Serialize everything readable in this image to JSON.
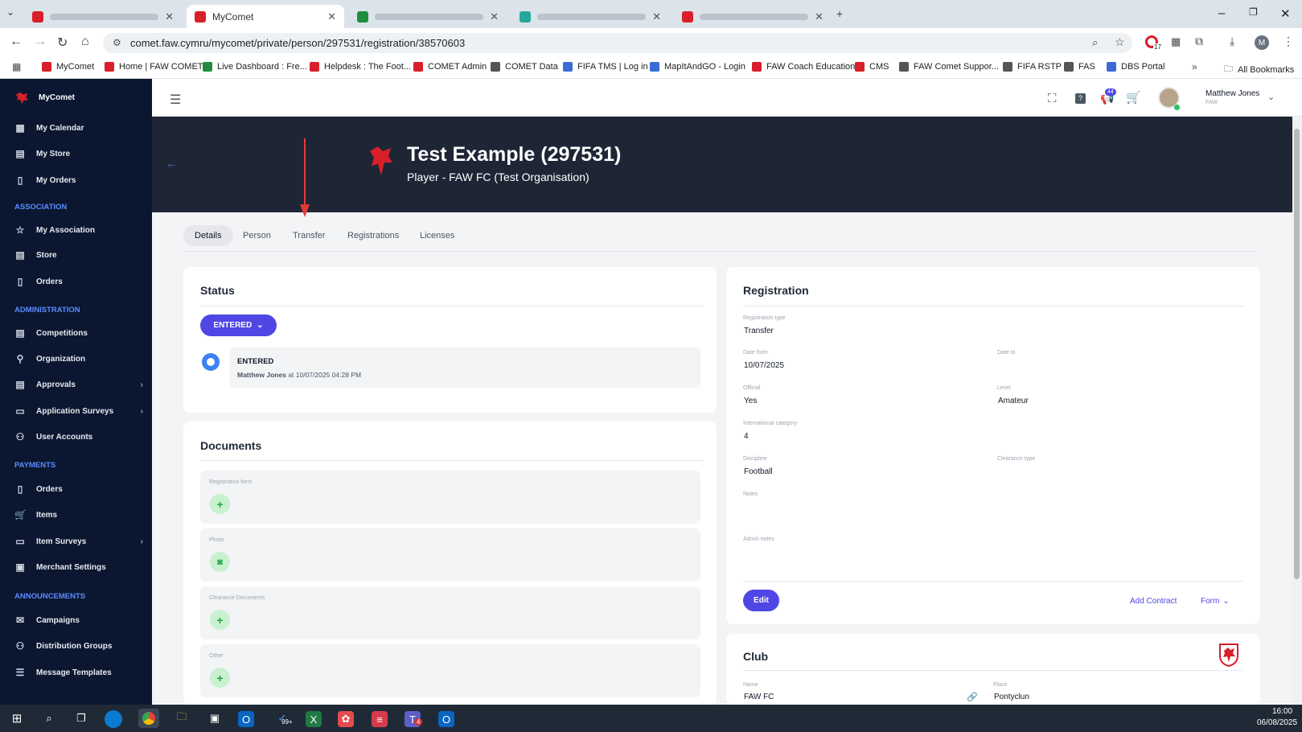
{
  "browser": {
    "tabs": [
      {
        "label": "",
        "active": false
      },
      {
        "label": "MyComet",
        "active": true
      },
      {
        "label": "",
        "active": false
      },
      {
        "label": "",
        "active": false
      },
      {
        "label": "",
        "active": false
      }
    ],
    "url": "comet.faw.cymru/mycomet/private/person/297531/registration/38570603",
    "extension_badge": "17",
    "profile_initial": "M",
    "bookmarks": [
      "MyComet",
      "Home | FAW COMET",
      "Live Dashboard : Fre...",
      "Helpdesk : The Foot...",
      "COMET Admin",
      "COMET Data",
      "FIFA TMS | Log in",
      "MapItAndGO - Login",
      "FAW Coach Education",
      "CMS",
      "FAW Comet Suppor...",
      "FIFA RSTP",
      "FAS",
      "DBS Portal"
    ],
    "all_bookmarks": "All Bookmarks"
  },
  "sidebar": {
    "title": "MyComet",
    "top_items": [
      "My Calendar",
      "My Store",
      "My Orders"
    ],
    "sections": [
      {
        "title": "ASSOCIATION",
        "items": [
          {
            "label": "My Association",
            "arrow": false
          },
          {
            "label": "Store",
            "arrow": false
          },
          {
            "label": "Orders",
            "arrow": false
          }
        ]
      },
      {
        "title": "ADMINISTRATION",
        "items": [
          {
            "label": "Competitions",
            "arrow": false
          },
          {
            "label": "Organization",
            "arrow": false
          },
          {
            "label": "Approvals",
            "arrow": true
          },
          {
            "label": "Application Surveys",
            "arrow": true
          },
          {
            "label": "User Accounts",
            "arrow": false
          }
        ]
      },
      {
        "title": "PAYMENTS",
        "items": [
          {
            "label": "Orders",
            "arrow": false
          },
          {
            "label": "Items",
            "arrow": false
          },
          {
            "label": "Item Surveys",
            "arrow": true
          },
          {
            "label": "Merchant Settings",
            "arrow": false
          }
        ]
      },
      {
        "title": "ANNOUNCEMENTS",
        "items": [
          {
            "label": "Campaigns",
            "arrow": false
          },
          {
            "label": "Distribution Groups",
            "arrow": false
          },
          {
            "label": "Message Templates",
            "arrow": false
          }
        ]
      }
    ]
  },
  "topbar": {
    "notification_count": "44",
    "user_name": "Matthew Jones",
    "user_org": "FAW"
  },
  "hero": {
    "title": "Test Example (297531)",
    "subtitle": "Player - FAW FC (Test Organisation)"
  },
  "tabs": [
    "Details",
    "Person",
    "Transfer",
    "Registrations",
    "Licenses"
  ],
  "status": {
    "heading": "Status",
    "button": "ENTERED",
    "entry_state": "ENTERED",
    "entry_user": "Matthew Jones",
    "entry_time": "at 10/07/2025 04:28 PM"
  },
  "documents": {
    "heading": "Documents",
    "items": [
      "Registration form",
      "Photo",
      "Clearance Documents",
      "Other"
    ]
  },
  "registration": {
    "heading": "Registration",
    "type_label": "Registration type",
    "type_value": "Transfer",
    "date_from_label": "Date from",
    "date_from_value": "10/07/2025",
    "date_to_label": "Date to",
    "official_label": "Official",
    "official_value": "Yes",
    "level_label": "Level",
    "level_value": "Amateur",
    "intl_label": "International category",
    "intl_value": "4",
    "discipline_label": "Discipline",
    "discipline_value": "Football",
    "clearance_label": "Clearance type",
    "notes_label": "Notes",
    "admin_notes_label": "Admin notes",
    "edit": "Edit",
    "add_contract": "Add Contract",
    "form": "Form"
  },
  "club": {
    "heading": "Club",
    "name_label": "Name",
    "name_value": "FAW FC",
    "place_label": "Place",
    "place_value": "Pontyclun"
  },
  "taskbar": {
    "mail_badge": "99+",
    "teams_badge": "4",
    "time": "16:00",
    "date": "06/08/2025"
  },
  "colors": {
    "sidebar": "#0b1730",
    "hero": "#1e2636",
    "accent": "#4f46e5",
    "section": "#5b8cff",
    "brand_red": "#d81f2a"
  }
}
